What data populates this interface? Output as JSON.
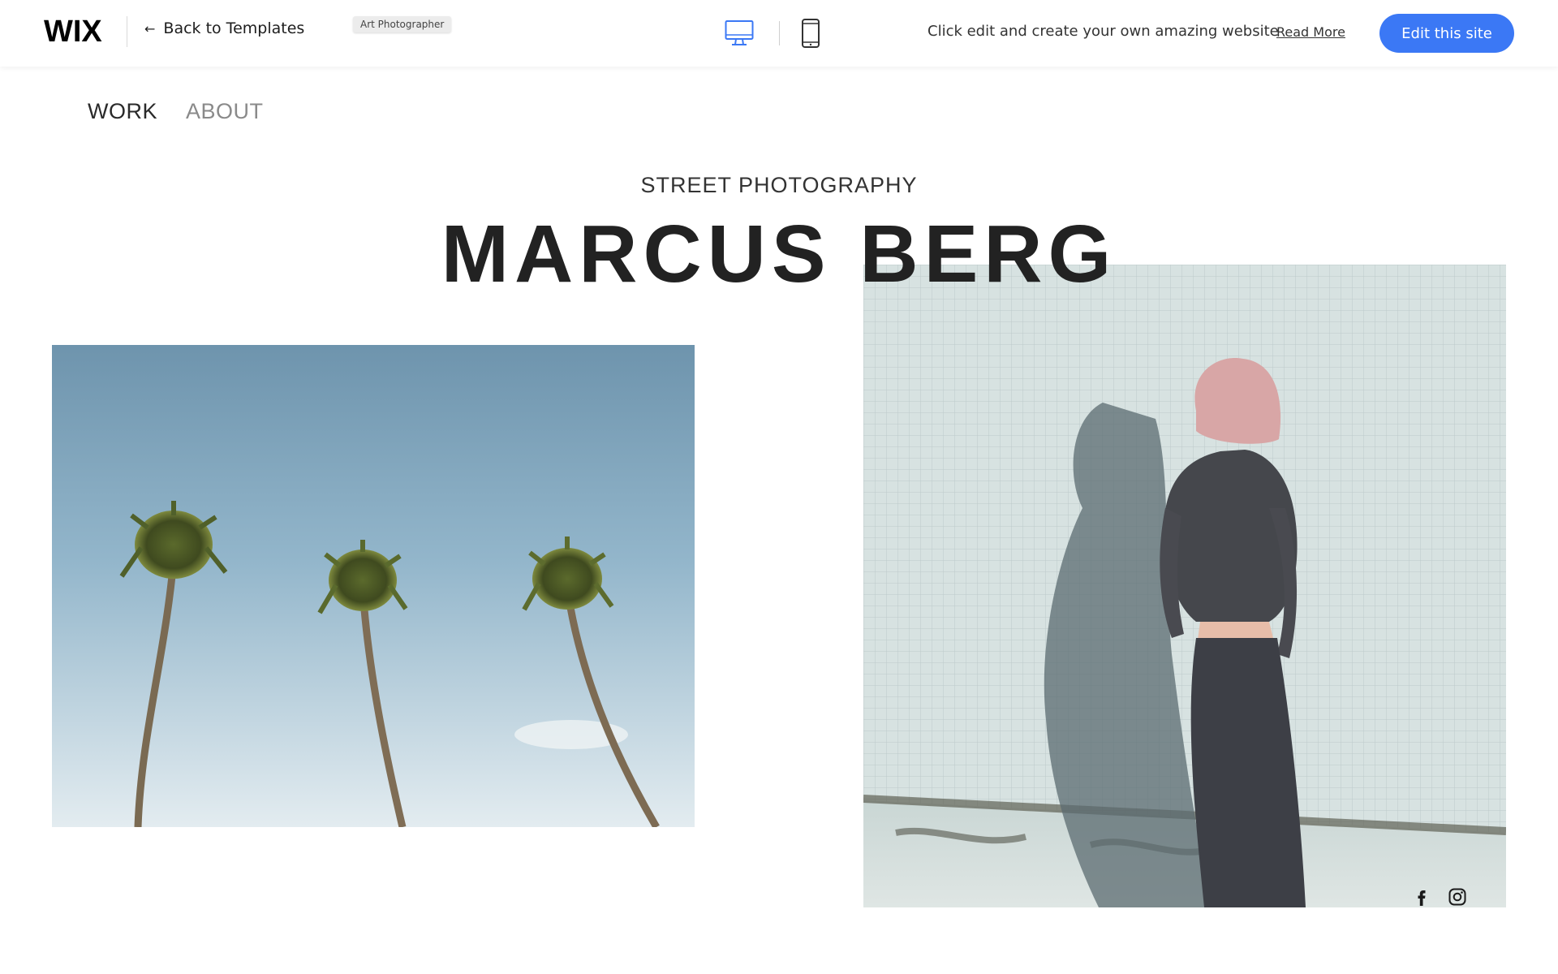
{
  "topbar": {
    "logo_text": "WIX",
    "back_label": "Back to Templates",
    "template_tag": "Art Photographer",
    "device_icons": [
      "desktop-icon",
      "mobile-icon"
    ],
    "promo_text": "Click edit and create your own amazing website",
    "read_more_label": "Read More",
    "edit_button_label": "Edit this site",
    "accent_color": "#3b78f5"
  },
  "site": {
    "nav": [
      {
        "label": "WORK",
        "active": true
      },
      {
        "label": "ABOUT",
        "active": false
      }
    ],
    "subtitle": "STREET PHOTOGRAPHY",
    "title": "MARCUS BERG",
    "social_icons": [
      "facebook-icon",
      "instagram-icon"
    ]
  }
}
